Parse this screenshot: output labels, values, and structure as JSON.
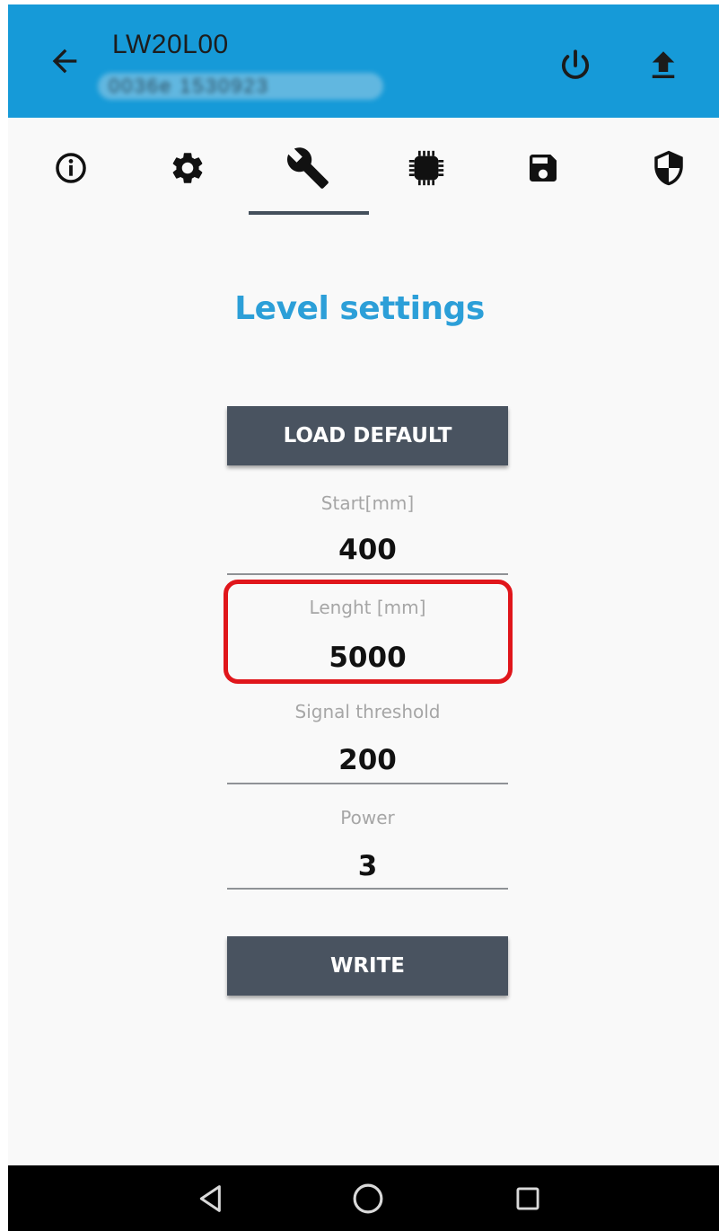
{
  "appbar": {
    "title": "LW20L00",
    "subtitle": "0036e 1530923",
    "icons": {
      "back": "arrow-back-icon",
      "power": "power-icon",
      "upload": "upload-icon"
    }
  },
  "tabs": [
    {
      "icon": "info-icon",
      "active": false
    },
    {
      "icon": "gear-icon",
      "active": false
    },
    {
      "icon": "wrench-icon",
      "active": true
    },
    {
      "icon": "chip-icon",
      "active": false
    },
    {
      "icon": "save-icon",
      "active": false
    },
    {
      "icon": "shield-icon",
      "active": false
    }
  ],
  "page": {
    "heading": "Level settings",
    "load_default_label": "LOAD DEFAULT",
    "write_label": "WRITE"
  },
  "fields": {
    "start": {
      "label": "Start[mm]",
      "value": "400"
    },
    "length": {
      "label": "Lenght [mm]",
      "value": "5000"
    },
    "signal_threshold": {
      "label": "Signal threshold",
      "value": "200"
    },
    "power": {
      "label": "Power",
      "value": "3"
    }
  },
  "colors": {
    "appbar": "#169ad8",
    "heading": "#2c9fd8",
    "button": "#495360",
    "highlight": "#e0161b"
  },
  "navbar": {
    "icons": [
      "back-triangle-icon",
      "home-circle-icon",
      "recents-square-icon"
    ]
  }
}
